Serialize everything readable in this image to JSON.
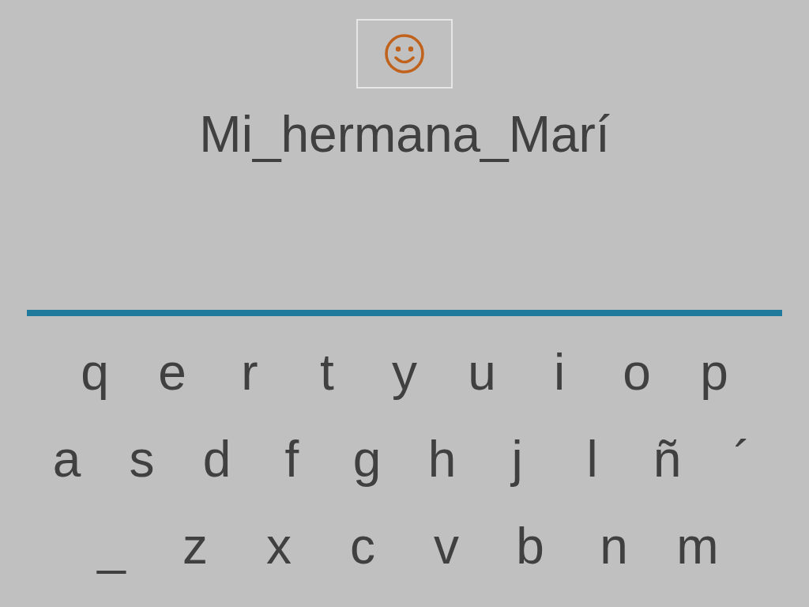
{
  "prompt": "Mi_hermana_Marí",
  "keyboard": {
    "rows": [
      [
        "q",
        "e",
        "r",
        "t",
        "y",
        "u",
        "i",
        "o",
        "p"
      ],
      [
        "a",
        "s",
        "d",
        "f",
        "g",
        "h",
        "j",
        "l",
        "ñ",
        "´"
      ],
      [
        "_",
        "z",
        "x",
        "c",
        "v",
        "b",
        "n",
        "m"
      ]
    ]
  }
}
